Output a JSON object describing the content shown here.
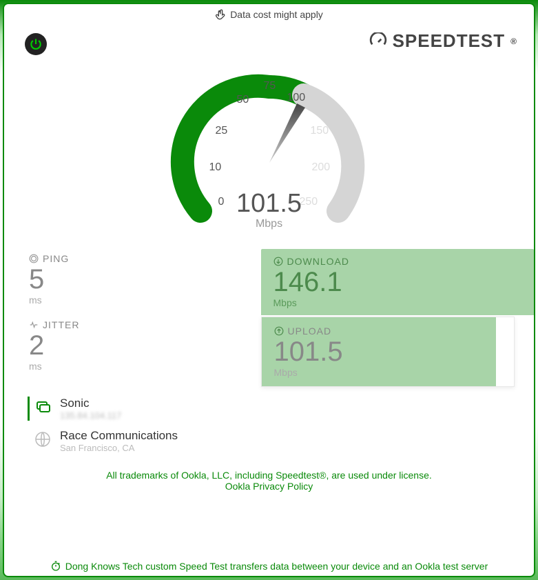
{
  "topNotice": "Data cost might apply",
  "brand": "SPEEDTEST",
  "gauge": {
    "ticks": {
      "t0": "0",
      "t10": "10",
      "t25": "25",
      "t50": "50",
      "t75": "75",
      "t100": "100",
      "t150": "150",
      "t200": "200",
      "t250": "250"
    },
    "value": "101.5",
    "unit": "Mbps"
  },
  "ping": {
    "label": "PING",
    "value": "5",
    "unit": "ms"
  },
  "jitter": {
    "label": "JITTER",
    "value": "2",
    "unit": "ms"
  },
  "download": {
    "label": "DOWNLOAD",
    "value": "146.1",
    "unit": "Mbps"
  },
  "upload": {
    "label": "UPLOAD",
    "value": "101.5",
    "unit": "Mbps"
  },
  "isp": {
    "name": "Sonic",
    "ip": "135.84.104.117"
  },
  "server": {
    "name": "Race Communications",
    "location": "San Francisco, CA"
  },
  "legal": "All trademarks of Ookla, LLC, including Speedtest®, are used under license.",
  "privacy": "Ookla Privacy Policy",
  "bottomNotice": "Dong Knows Tech custom Speed Test transfers data between your device and an Ookla test server",
  "chart_data": {
    "type": "gauge",
    "title": "Speedtest",
    "unit": "Mbps",
    "value": 101.5,
    "range": [
      0,
      250
    ],
    "fill_to": 100,
    "ticks": [
      0,
      10,
      25,
      50,
      75,
      100,
      150,
      200,
      250
    ]
  }
}
